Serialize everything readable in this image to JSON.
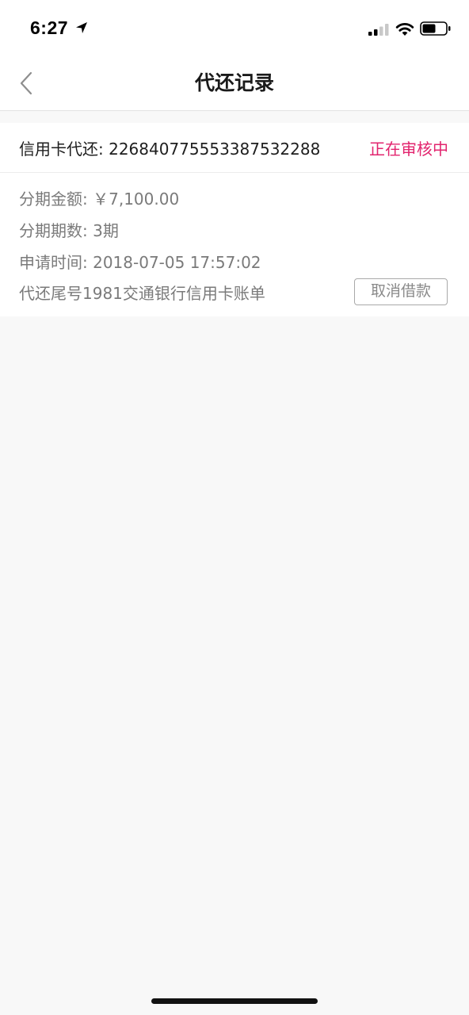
{
  "status_bar": {
    "time": "6:27",
    "icons": [
      "location-arrow-icon",
      "cellular-signal-icon",
      "wifi-icon",
      "battery-icon"
    ]
  },
  "nav": {
    "title": "代还记录",
    "back_icon": "chevron-left-icon"
  },
  "record": {
    "header_label": "信用卡代还:",
    "order_number": "226840775553387532288",
    "status": "正在审核中",
    "amount_label": "分期金额:",
    "amount_value": "￥7,100.00",
    "periods_label": "分期期数:",
    "periods_value": "3期",
    "apply_time_label": "申请时间:",
    "apply_time_value": "2018-07-05 17:57:02",
    "description": "代还尾号1981交通银行信用卡账单",
    "cancel_label": "取消借款"
  },
  "colors": {
    "status_accent": "#e2246e",
    "page_background": "#f8f8f8",
    "card_background": "#ffffff",
    "secondary_text": "#7a7a7a"
  }
}
